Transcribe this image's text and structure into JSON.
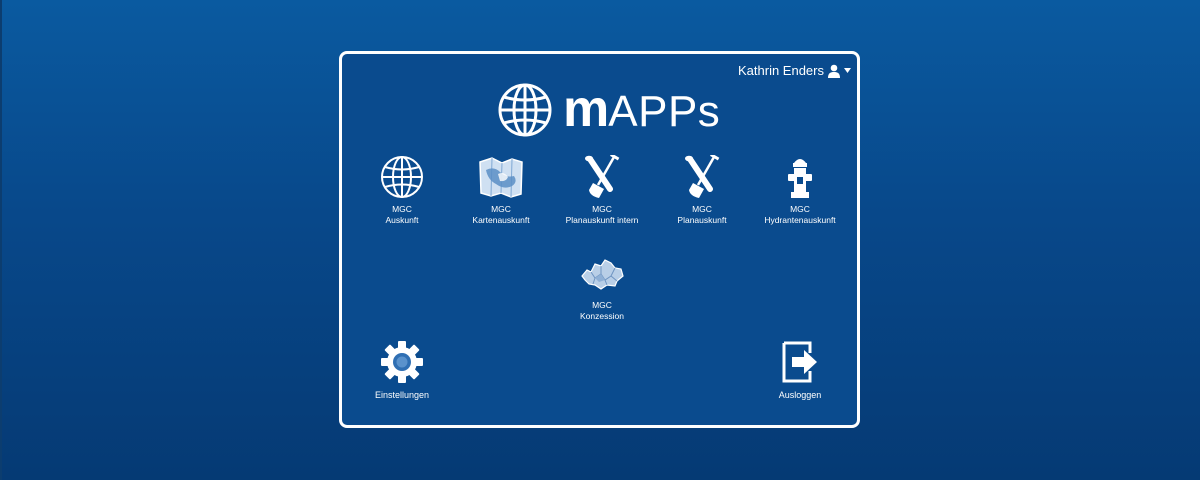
{
  "user": {
    "name": "Kathrin Enders",
    "icon": "user-icon",
    "dropdown_icon": "caret-down-icon"
  },
  "logo": {
    "text_bold": "m",
    "text_rest": "APPs",
    "icon": "globe-icon"
  },
  "apps": [
    {
      "line1": "MGC",
      "line2": "Auskunft",
      "icon": "globe-icon"
    },
    {
      "line1": "MGC",
      "line2": "Kartenauskunft",
      "icon": "map-icon"
    },
    {
      "line1": "MGC",
      "line2": "Planauskunft intern",
      "icon": "shovel-pipe-icon"
    },
    {
      "line1": "MGC",
      "line2": "Planauskunft",
      "icon": "shovel-pipe-icon"
    },
    {
      "line1": "MGC",
      "line2": "Hydrantenauskunft",
      "icon": "hydrant-icon"
    },
    {
      "line1": "MGC",
      "line2": "Konzession",
      "icon": "region-map-icon"
    }
  ],
  "settings": {
    "label": "Einstellungen",
    "icon": "gear-icon"
  },
  "logout": {
    "label": "Ausloggen",
    "icon": "logout-icon"
  },
  "colors": {
    "background": "#08488a",
    "panel": "#0a4b8e",
    "border": "#ffffff",
    "text": "#ffffff"
  }
}
